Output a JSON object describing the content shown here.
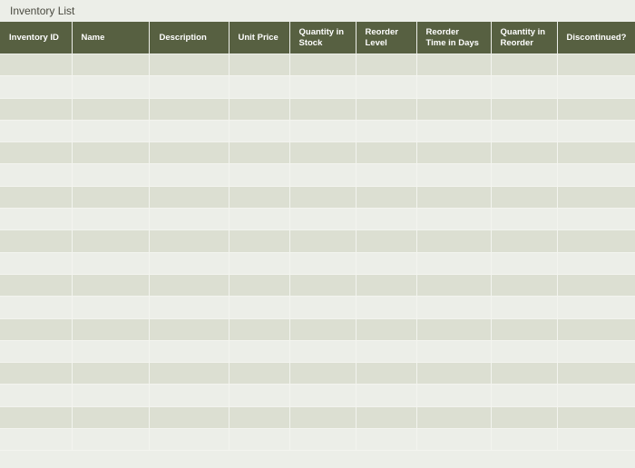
{
  "title": "Inventory List",
  "columns": [
    "Inventory ID",
    "Name",
    "Description",
    "Unit Price",
    "Quantity in Stock",
    "Reorder Level",
    "Reorder Time in Days",
    "Quantity in Reorder",
    "Discontinued?"
  ],
  "row_count": 18,
  "colors": {
    "header": "#576041",
    "row_alt": "#dcdfd2",
    "row": "#eceee8"
  }
}
